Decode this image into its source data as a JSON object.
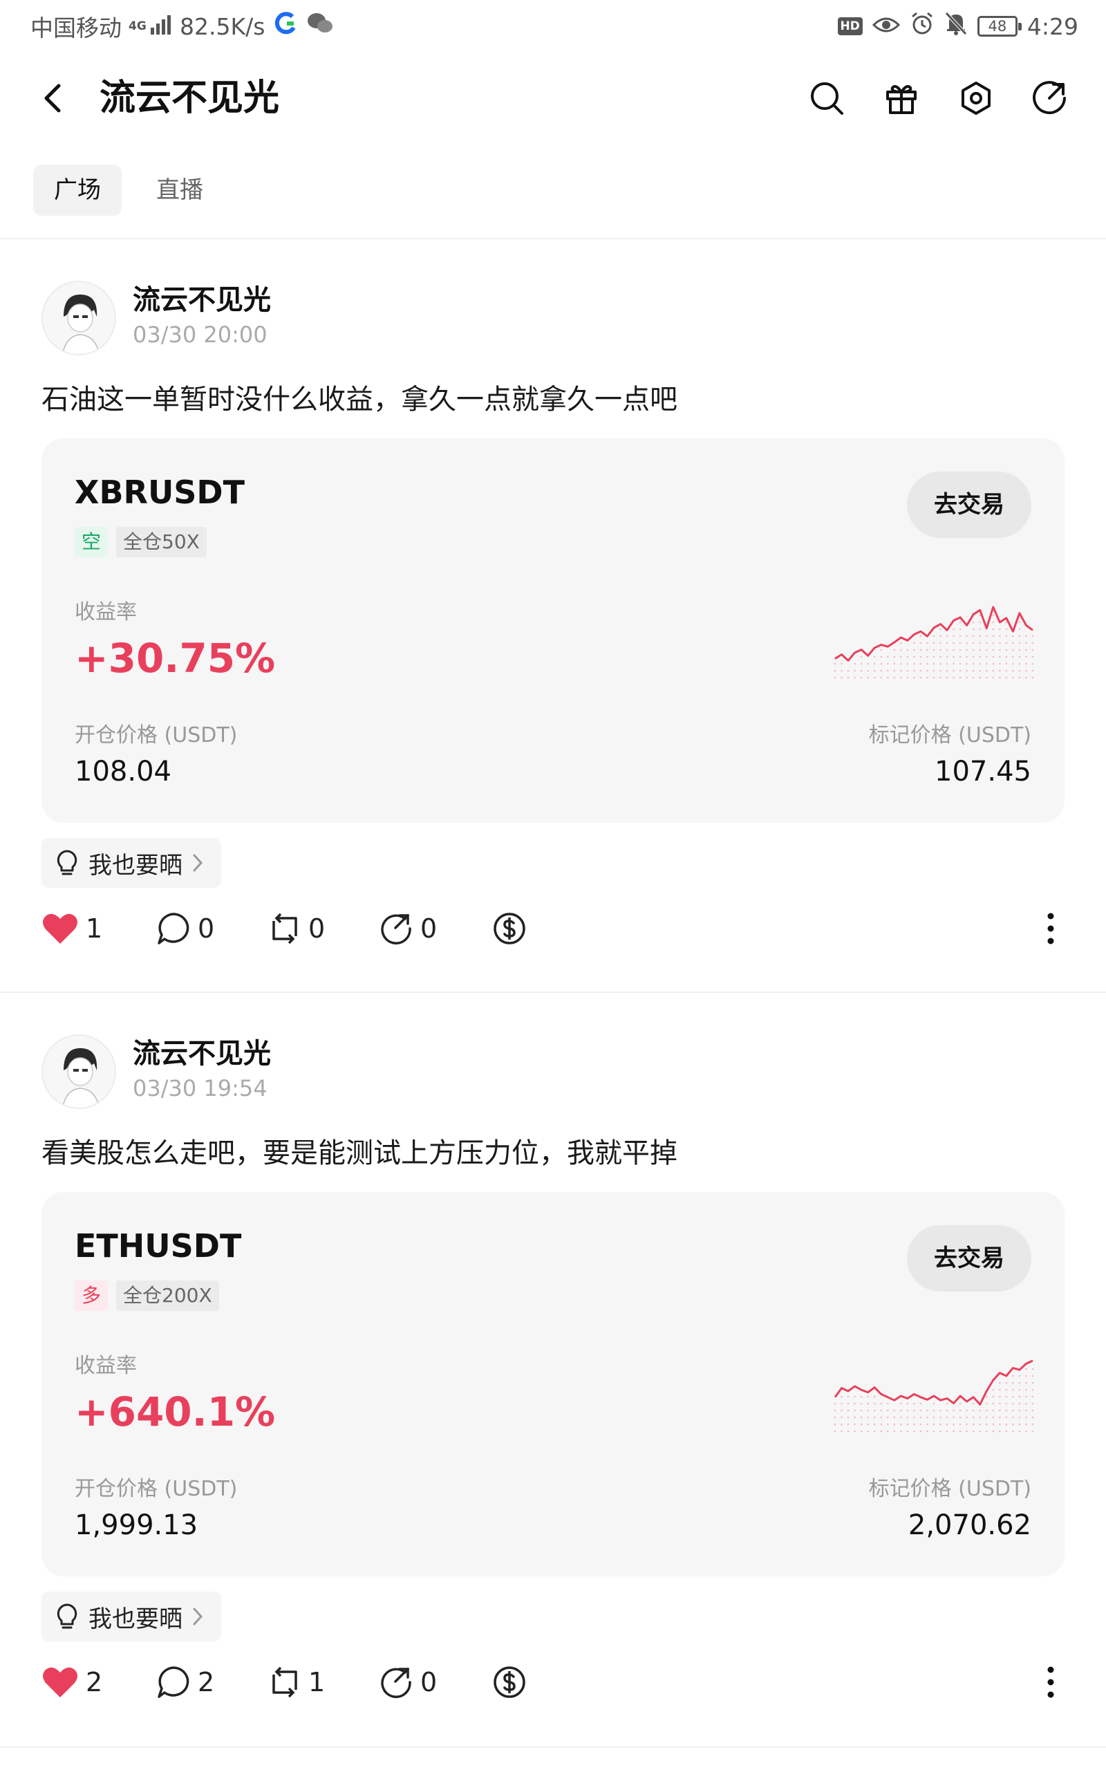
{
  "status_bar": {
    "carrier": "中国移动",
    "network": "4G",
    "speed": "82.5K/s",
    "hd": "HD",
    "battery": "48",
    "time": "4:29"
  },
  "header": {
    "title": "流云不见光",
    "icons": [
      "back-icon",
      "search-icon",
      "gift-icon",
      "settings-icon",
      "share-icon"
    ]
  },
  "tabs": [
    {
      "label": "广场",
      "active": true
    },
    {
      "label": "直播",
      "active": false
    }
  ],
  "posts": [
    {
      "author": "流云不见光",
      "time": "03/30 20:00",
      "text": "石油这一单暂时没什么收益，拿久一点就拿久一点吧",
      "card": {
        "symbol": "XBRUSDT",
        "direction": "空",
        "margin": "全仓50X",
        "trade_label": "去交易",
        "return_label": "收益率",
        "return_value": "+30.75%",
        "open_label": "开仓价格 (USDT)",
        "open_price": "108.04",
        "mark_label": "标记价格 (USDT)",
        "mark_price": "107.45",
        "trend": [
          0.15,
          0.22,
          0.12,
          0.25,
          0.3,
          0.2,
          0.33,
          0.38,
          0.35,
          0.42,
          0.5,
          0.45,
          0.55,
          0.6,
          0.52,
          0.66,
          0.72,
          0.62,
          0.78,
          0.83,
          0.7,
          0.88,
          0.95,
          0.65,
          1.0,
          0.75,
          0.82,
          0.6,
          0.9,
          0.7,
          0.62
        ]
      },
      "share_label": "我也要晒",
      "likes": "1",
      "comments": "0",
      "reposts": "0",
      "shares": "0"
    },
    {
      "author": "流云不见光",
      "time": "03/30 19:54",
      "text": "看美股怎么走吧，要是能测试上方压力位，我就平掉",
      "card": {
        "symbol": "ETHUSDT",
        "direction": "多",
        "margin": "全仓200X",
        "trade_label": "去交易",
        "return_label": "收益率",
        "return_value": "+640.1%",
        "open_label": "开仓价格 (USDT)",
        "open_price": "1,999.13",
        "mark_label": "标记价格 (USDT)",
        "mark_price": "2,070.62",
        "trend": [
          0.4,
          0.55,
          0.5,
          0.58,
          0.52,
          0.48,
          0.56,
          0.45,
          0.4,
          0.35,
          0.42,
          0.38,
          0.45,
          0.4,
          0.36,
          0.42,
          0.35,
          0.38,
          0.3,
          0.42,
          0.33,
          0.4,
          0.28,
          0.5,
          0.68,
          0.8,
          0.75,
          0.88,
          0.85,
          0.95,
          1.0
        ]
      },
      "share_label": "我也要晒",
      "likes": "2",
      "comments": "2",
      "reposts": "1",
      "shares": "0"
    }
  ],
  "colors": {
    "accent_red": "#e8405c",
    "short_green": "#17a864",
    "card_bg": "#f6f6f6"
  }
}
